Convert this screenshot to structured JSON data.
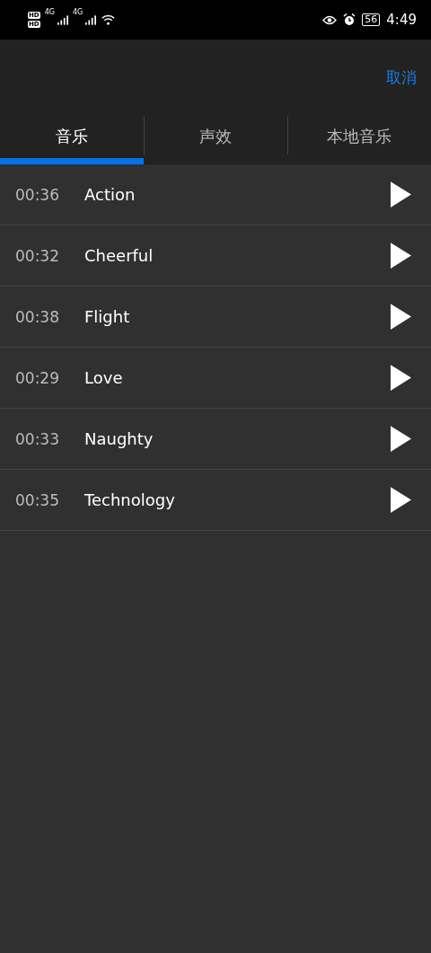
{
  "status_bar": {
    "hd_labels": [
      "HD",
      "HD"
    ],
    "network_labels": [
      "4G",
      "4G"
    ],
    "battery": "56",
    "time": "4:49"
  },
  "header": {
    "cancel": "取消"
  },
  "tabs": [
    {
      "label": "音乐",
      "selected": true
    },
    {
      "label": "声效",
      "selected": false
    },
    {
      "label": "本地音乐",
      "selected": false
    }
  ],
  "tracks": [
    {
      "duration": "00:36",
      "title": "Action"
    },
    {
      "duration": "00:32",
      "title": "Cheerful"
    },
    {
      "duration": "00:38",
      "title": "Flight"
    },
    {
      "duration": "00:29",
      "title": "Love"
    },
    {
      "duration": "00:33",
      "title": "Naughty"
    },
    {
      "duration": "00:35",
      "title": "Technology"
    }
  ]
}
